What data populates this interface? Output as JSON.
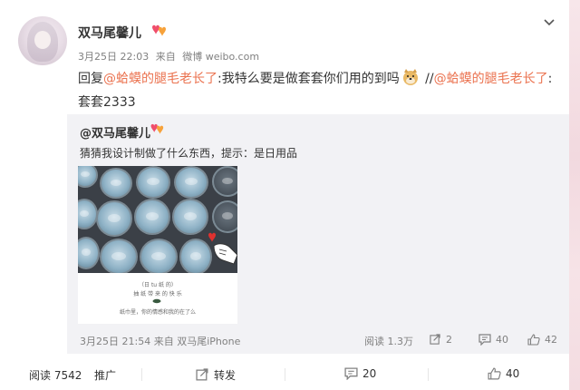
{
  "post": {
    "user_name": "双马尾馨儿",
    "meta_time": "3月25日 22:03",
    "meta_from": "来自",
    "meta_source": "微博 weibo.com",
    "reply_prefix": "回复",
    "mention1": "@蛤蟆的腿毛老长了",
    "reply_body": ":我特么要是做套套你们用的到吗",
    "separator": " //",
    "mention2": "@蛤蟆的腿毛老长了",
    "reply_tail": ":套套2333"
  },
  "repost": {
    "user_name": "@双马尾馨儿",
    "text": "猜猜我设计制做了什么东西，提示：是日用品",
    "photo": {
      "line1": "（日  tu  纸  的）",
      "line2": "抽 纸 带 来 的 快 乐",
      "line3": "纸巾里，你的情感和我的在了么"
    },
    "time": "3月25日 21:54",
    "from": "来自",
    "source": "双马尾iPhone",
    "reads": "阅读 1.3万",
    "reposts": "2",
    "comments": "40",
    "likes": "42"
  },
  "actions": {
    "reads": "阅读 7542",
    "promote": "推广",
    "repost": "转发",
    "comment": "20",
    "like": "40"
  },
  "icons": {
    "badge": "vip-heart-badge-icon",
    "chevron": "chevron-down-icon",
    "repost": "repost-icon",
    "comment": "comment-icon",
    "like": "thumbs-up-icon"
  },
  "colors": {
    "mention": "#eb7350",
    "meta": "#808080",
    "repost_bg": "#f2f2f5"
  }
}
